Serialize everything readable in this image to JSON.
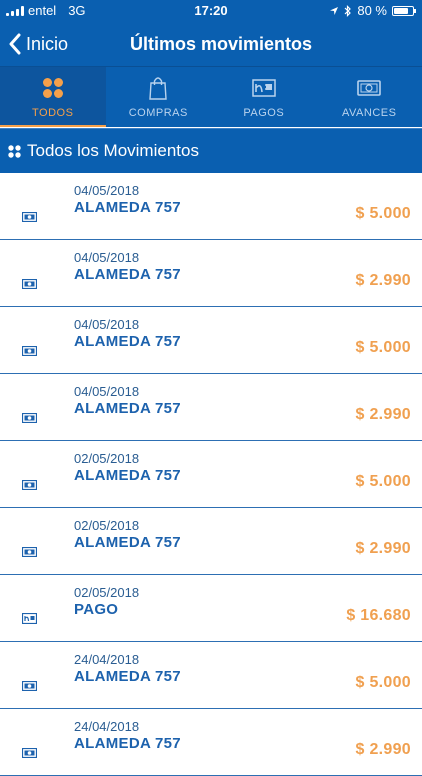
{
  "status_bar": {
    "carrier": "entel",
    "network": "3G",
    "time": "17:20",
    "battery": "80 %"
  },
  "nav": {
    "back_label": "Inicio",
    "title": "Últimos movimientos"
  },
  "tabs": [
    {
      "label": "TODOS",
      "icon": "grid-icon",
      "active": true
    },
    {
      "label": "COMPRAS",
      "icon": "shopping-bag-icon",
      "active": false
    },
    {
      "label": "PAGOS",
      "icon": "payment-icon",
      "active": false
    },
    {
      "label": "AVANCES",
      "icon": "cash-icon",
      "active": false
    }
  ],
  "section": {
    "title": "Todos los Movimientos"
  },
  "movements": [
    {
      "date": "04/05/2018",
      "name": "ALAMEDA 757",
      "amount": "$ 5.000",
      "icon": "cash-icon"
    },
    {
      "date": "04/05/2018",
      "name": "ALAMEDA 757",
      "amount": "$ 2.990",
      "icon": "cash-icon"
    },
    {
      "date": "04/05/2018",
      "name": "ALAMEDA 757",
      "amount": "$ 5.000",
      "icon": "cash-icon"
    },
    {
      "date": "04/05/2018",
      "name": "ALAMEDA 757",
      "amount": "$ 2.990",
      "icon": "cash-icon"
    },
    {
      "date": "02/05/2018",
      "name": "ALAMEDA 757",
      "amount": "$ 5.000",
      "icon": "cash-icon"
    },
    {
      "date": "02/05/2018",
      "name": "ALAMEDA 757",
      "amount": "$ 2.990",
      "icon": "cash-icon"
    },
    {
      "date": "02/05/2018",
      "name": "PAGO",
      "amount": "$ 16.680",
      "icon": "payment-icon"
    },
    {
      "date": "24/04/2018",
      "name": "ALAMEDA 757",
      "amount": "$ 5.000",
      "icon": "cash-icon"
    },
    {
      "date": "24/04/2018",
      "name": "ALAMEDA 757",
      "amount": "$ 2.990",
      "icon": "cash-icon"
    }
  ],
  "colors": {
    "primary": "#0a5fb0",
    "accent": "#f5a04a",
    "amount": "#f0a050",
    "text_blue": "#1d62ad"
  }
}
